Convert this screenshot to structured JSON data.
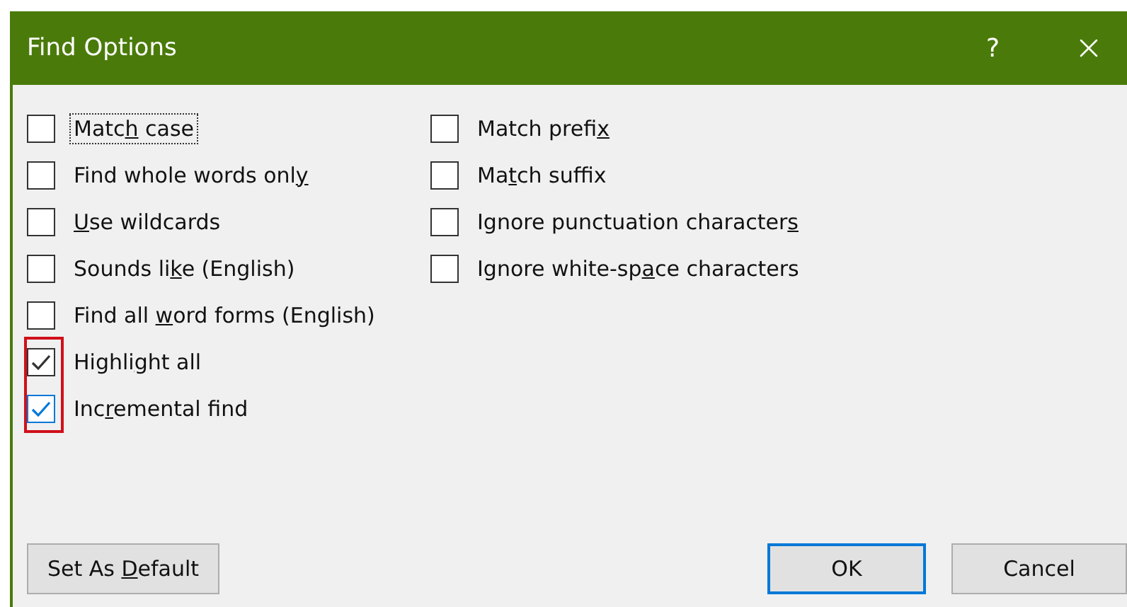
{
  "window": {
    "title": "Find Options",
    "help": "?"
  },
  "options_left": [
    {
      "pre": "Matc",
      "key": "h",
      "post": " case",
      "checked": false,
      "focused": true,
      "hovered": false
    },
    {
      "pre": "Find whole words onl",
      "key": "y",
      "checked": false,
      "focused": false,
      "hovered": false
    },
    {
      "key": "U",
      "post": "se wildcards",
      "checked": false,
      "focused": false,
      "hovered": false
    },
    {
      "pre": "Sounds li",
      "key": "k",
      "post": "e (English)",
      "checked": false,
      "focused": false,
      "hovered": false
    },
    {
      "pre": "Find all ",
      "key": "w",
      "post": "ord forms (English)",
      "checked": false,
      "focused": false,
      "hovered": false
    },
    {
      "pre": "Highli",
      "key": "g",
      "post": "ht all",
      "checked": true,
      "focused": false,
      "hovered": false
    },
    {
      "pre": "Inc",
      "key": "r",
      "post": "emental find",
      "checked": true,
      "focused": false,
      "hovered": true
    }
  ],
  "options_right": [
    {
      "pre": "Match prefi",
      "key": "x",
      "checked": false,
      "focused": false,
      "hovered": false
    },
    {
      "pre": "Ma",
      "key": "t",
      "post": "ch suffix",
      "checked": false,
      "focused": false,
      "hovered": false
    },
    {
      "pre": "Ignore punctuation character",
      "key": "s",
      "checked": false,
      "focused": false,
      "hovered": false
    },
    {
      "pre": "Ignore white-sp",
      "key": "a",
      "post": "ce characters",
      "checked": false,
      "focused": false,
      "hovered": false
    }
  ],
  "buttons": [
    {
      "kind": "left",
      "pre": "Set As ",
      "key": "D",
      "post": "efault",
      "default": false
    },
    {
      "kind": "right",
      "pre": "OK",
      "default": true
    },
    {
      "kind": "right",
      "pre": "Cancel",
      "default": false
    }
  ]
}
